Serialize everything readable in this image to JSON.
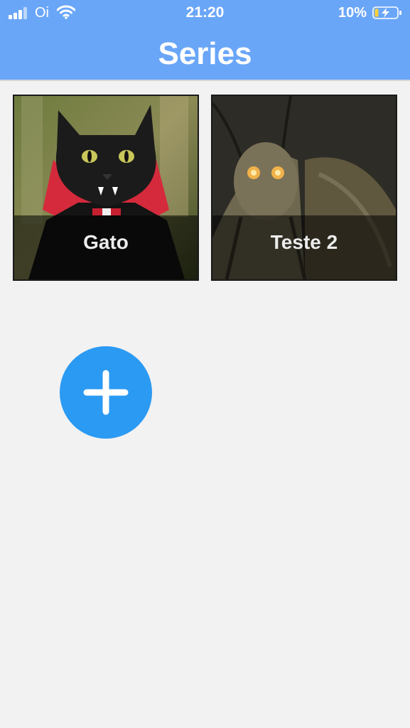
{
  "status_bar": {
    "carrier": "Oi",
    "time": "21:20",
    "battery_percent": "10%",
    "signal_icon": "signal-bars-icon",
    "wifi_icon": "wifi-icon",
    "battery_icon": "battery-charging-icon"
  },
  "header": {
    "title": "Series",
    "background_color": "#6aa6f8"
  },
  "series": [
    {
      "label": "Gato",
      "image": "black cat wearing red vampire cape"
    },
    {
      "label": "Teste 2",
      "image": "moth with glowing eyes"
    }
  ],
  "fab": {
    "icon": "plus-icon",
    "color": "#2b9af3"
  }
}
